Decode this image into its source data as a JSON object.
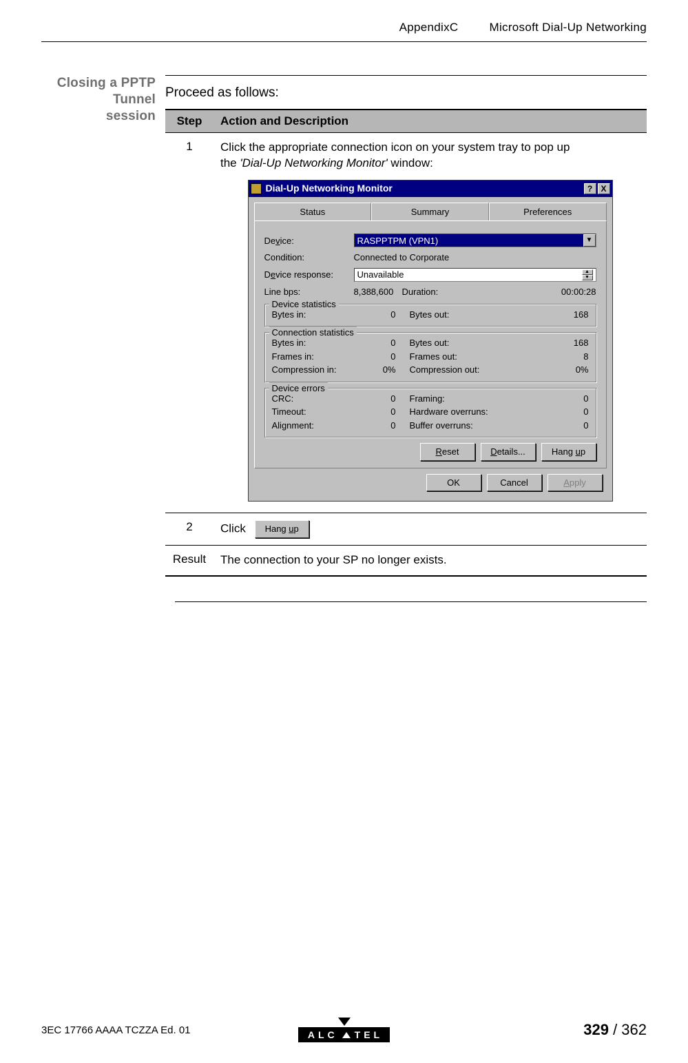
{
  "header": {
    "appendix": "AppendixC",
    "title": "Microsoft Dial-Up Networking"
  },
  "section": {
    "sideheading_l1": "Closing a PPTP Tunnel",
    "sideheading_l2": "session",
    "lead": "Proceed as follows:"
  },
  "table": {
    "head_step": "Step",
    "head_action": "Action and Description",
    "row1": {
      "num": "1",
      "text_a": "Click the appropriate connection icon on your system tray to pop up",
      "text_b": "the ",
      "text_c": "'Dial-Up Networking Monitor'",
      "text_d": " window:"
    },
    "row2": {
      "num": "2",
      "text": "Click",
      "button_prefix": "Hang ",
      "button_u": "u",
      "button_suffix": "p"
    },
    "row3": {
      "num": "Result",
      "text": "The connection to your SP no longer exists."
    }
  },
  "dialog": {
    "title": "Dial-Up Networking Monitor",
    "help": "?",
    "close": "X",
    "tabs": {
      "status": "Status",
      "summary": "Summary",
      "prefs": "Preferences"
    },
    "device_lbl_pre": "De",
    "device_lbl_u": "v",
    "device_lbl_post": "ice:",
    "device_val": "RASPPTPM (VPN1)",
    "condition_lbl": "Condition:",
    "condition_val": "Connected to Corporate",
    "resp_lbl_pre": "D",
    "resp_lbl_u": "e",
    "resp_lbl_post": "vice response:",
    "resp_val": "Unavailable",
    "line_lbl": "Line bps:",
    "line_val": "8,388,600",
    "duration_lbl": "Duration:",
    "duration_val": "00:00:28",
    "grp_device": "Device statistics",
    "dev_in_lbl": "Bytes in:",
    "dev_in_val": "0",
    "dev_out_lbl": "Bytes out:",
    "dev_out_val": "168",
    "grp_conn": "Connection statistics",
    "conn_in_lbl": "Bytes in:",
    "conn_in_val": "0",
    "conn_out_lbl": "Bytes out:",
    "conn_out_val": "168",
    "frames_in_lbl": "Frames in:",
    "frames_in_val": "0",
    "frames_out_lbl": "Frames out:",
    "frames_out_val": "8",
    "comp_in_lbl": "Compression in:",
    "comp_in_val": "0%",
    "comp_out_lbl": "Compression out:",
    "comp_out_val": "0%",
    "grp_err": "Device errors",
    "crc_lbl": "CRC:",
    "crc_val": "0",
    "framing_lbl": "Framing:",
    "framing_val": "0",
    "timeout_lbl": "Timeout:",
    "timeout_val": "0",
    "hw_lbl": "Hardware overruns:",
    "hw_val": "0",
    "align_lbl": "Alignment:",
    "align_val": "0",
    "buf_lbl": "Buffer overruns:",
    "buf_val": "0",
    "btn_reset_u": "R",
    "btn_reset_post": "eset",
    "btn_details_u": "D",
    "btn_details_post": "etails...",
    "btn_hangup_pre": "Hang ",
    "btn_hangup_u": "u",
    "btn_hangup_post": "p",
    "btn_ok": "OK",
    "btn_cancel": "Cancel",
    "btn_apply_u": "A",
    "btn_apply_post": "pply"
  },
  "footer": {
    "docno": "3EC 17766 AAAA TCZZA Ed. 01",
    "logo_a": "ALC",
    "logo_b": "TEL",
    "page_current": "329",
    "page_sep": " / ",
    "page_total": "362"
  }
}
